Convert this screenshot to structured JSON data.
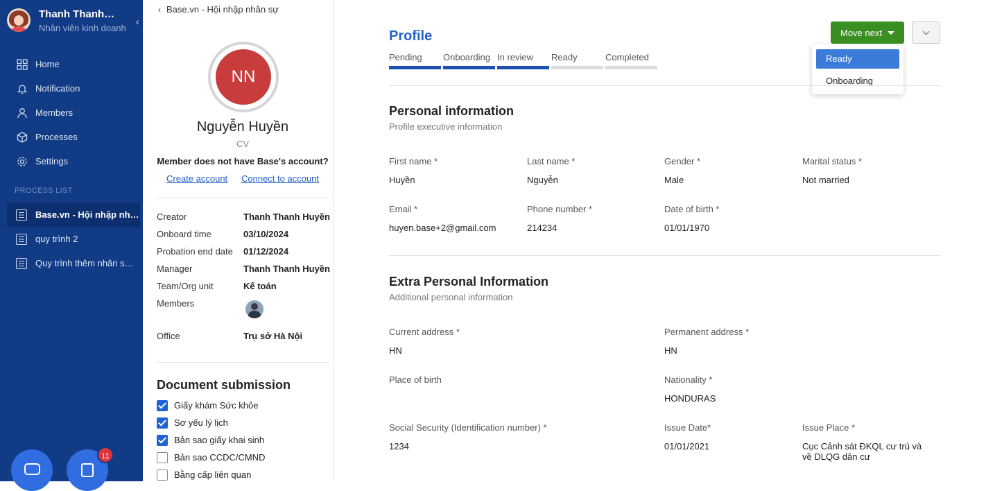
{
  "user": {
    "name": "Thanh Thanh Huyền",
    "role": "Nhân viên kinh doanh"
  },
  "nav": [
    {
      "label": "Home",
      "icon": "grid-icon"
    },
    {
      "label": "Notification",
      "icon": "bell-icon"
    },
    {
      "label": "Members",
      "icon": "person-icon"
    },
    {
      "label": "Processes",
      "icon": "cube-icon"
    },
    {
      "label": "Settings",
      "icon": "gear-icon"
    }
  ],
  "process_section": "PROCESS LIST",
  "processes": [
    "Base.vn - Hội nhập nhân sự",
    "quy trình 2",
    "Quy trình thêm nhân sự mới"
  ],
  "fab_badge": "11",
  "detail": {
    "back": "Base.vn - Hội nhập nhân sự",
    "initials": "NN",
    "name": "Nguyễn Huyền",
    "title": "CV",
    "no_account": "Member does not have Base's account?",
    "create_account": "Create account",
    "connect_account": "Connect to account",
    "info": [
      {
        "k": "Creator",
        "v": "Thanh Thanh Huyền"
      },
      {
        "k": "Onboard time",
        "v": "03/10/2024"
      },
      {
        "k": "Probation end date",
        "v": "01/12/2024"
      },
      {
        "k": "Manager",
        "v": "Thanh Thanh Huyền"
      },
      {
        "k": "Team/Org unit",
        "v": "Kế toán"
      },
      {
        "k": "Members",
        "v": ""
      },
      {
        "k": "Office",
        "v": "Trụ sở Hà Nội"
      }
    ],
    "doc_title": "Document submission",
    "docs": [
      {
        "label": "Giấy khám Sức khỏe",
        "checked": true
      },
      {
        "label": "Sơ yếu lý lịch",
        "checked": true
      },
      {
        "label": "Bản sao giấy khai sinh",
        "checked": true
      },
      {
        "label": "Bản sao CCDC/CMND",
        "checked": false
      },
      {
        "label": "Bằng cấp liên quan",
        "checked": false
      }
    ]
  },
  "profile": {
    "title": "Profile",
    "steps": [
      {
        "label": "Pending",
        "done": true
      },
      {
        "label": "Onboarding",
        "done": true
      },
      {
        "label": "In review",
        "done": true
      },
      {
        "label": "Ready",
        "done": false
      },
      {
        "label": "Completed",
        "done": false
      }
    ],
    "move_next": "Move next",
    "menu": [
      "Ready",
      "Onboarding"
    ],
    "personal": {
      "title": "Personal information",
      "subtitle": "Profile executive information",
      "fields": [
        {
          "label": "First name *",
          "value": "Huyền"
        },
        {
          "label": "Last name *",
          "value": "Nguyễn"
        },
        {
          "label": "Gender *",
          "value": "Male"
        },
        {
          "label": "Marital status *",
          "value": "Not married"
        },
        {
          "label": "Email *",
          "value": "huyen.base+2@gmail.com"
        },
        {
          "label": "Phone number *",
          "value": "214234"
        },
        {
          "label": "Date of birth *",
          "value": "01/01/1970"
        }
      ]
    },
    "extra": {
      "title": "Extra Personal Information",
      "subtitle": "Additional personal information",
      "fields": [
        {
          "label": "Current address *",
          "value": "HN"
        },
        {
          "label": "Permanent address *",
          "value": "HN"
        },
        {
          "label": "Place of birth",
          "value": ""
        },
        {
          "label": "Nationality *",
          "value": "HONDURAS"
        },
        {
          "label": "Social Security (Identification number) *",
          "value": "1234"
        },
        {
          "label": "Issue Date*",
          "value": "01/01/2021"
        },
        {
          "label": "Issue Place *",
          "value": "Cục Cảnh sát ĐKQL cư trú và về DLQG dân cư"
        }
      ]
    }
  }
}
